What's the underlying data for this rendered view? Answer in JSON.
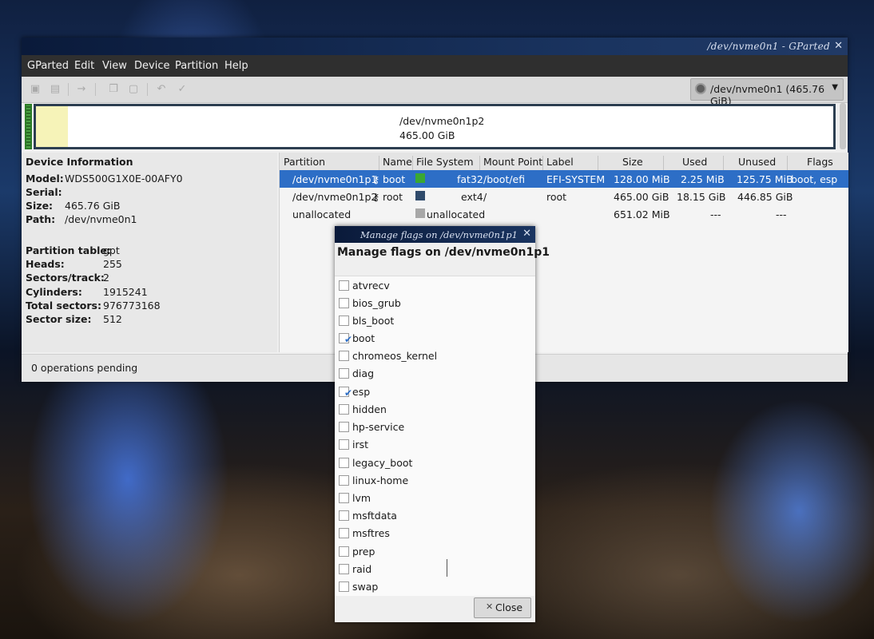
{
  "window": {
    "title": "/dev/nvme0n1 - GParted"
  },
  "menu": [
    "GParted",
    "Edit",
    "View",
    "Device",
    "Partition",
    "Help"
  ],
  "device_selector": "/dev/nvme0n1 (465.76 GiB)",
  "graph": {
    "label": "/dev/nvme0n1p2",
    "size": "465.00 GiB",
    "used_fraction": 0.04
  },
  "device_info": {
    "header": "Device Information",
    "rows": [
      {
        "k": "Model:",
        "v": "WDS500G1X0E-00AFY0"
      },
      {
        "k": "Serial:",
        "v": ""
      },
      {
        "k": "Size:",
        "v": "465.76 GiB"
      },
      {
        "k": "Path:",
        "v": "/dev/nvme0n1"
      }
    ],
    "rows2": [
      {
        "k": "Partition table:",
        "v": "gpt"
      },
      {
        "k": "Heads:",
        "v": "255"
      },
      {
        "k": "Sectors/track:",
        "v": "2"
      },
      {
        "k": "Cylinders:",
        "v": "1915241"
      },
      {
        "k": "Total sectors:",
        "v": "976773168"
      },
      {
        "k": "Sector size:",
        "v": "512"
      }
    ]
  },
  "table": {
    "headers": [
      "Partition",
      "Name",
      "File System",
      "Mount Point",
      "Label",
      "Size",
      "Used",
      "Unused",
      "Flags"
    ],
    "rows": [
      {
        "partition": "/dev/nvme0n1p1",
        "name": "boot",
        "fs": "fat32",
        "fs_color": "#3aa832",
        "mount": "/boot/efi",
        "label": "EFI-SYSTEM",
        "size": "128.00 MiB",
        "used": "2.25 MiB",
        "unused": "125.75 MiB",
        "flags": "boot, esp"
      },
      {
        "partition": "/dev/nvme0n1p2",
        "name": "root",
        "fs": "ext4",
        "fs_color": "#2f4a6b",
        "mount": "/",
        "label": "root",
        "size": "465.00 GiB",
        "used": "18.15 GiB",
        "unused": "446.85 GiB",
        "flags": ""
      },
      {
        "partition": "unallocated",
        "name": "",
        "fs": "unallocated",
        "fs_color": "#a8a8a8",
        "mount": "",
        "label": "",
        "size": "651.02 MiB",
        "used": "---",
        "unused": "---",
        "flags": ""
      }
    ]
  },
  "status": "0 operations pending",
  "dialog": {
    "title": "Manage flags on /dev/nvme0n1p1",
    "heading": "Manage flags on /dev/nvme0n1p1",
    "flags": [
      {
        "name": "atvrecv",
        "checked": false
      },
      {
        "name": "bios_grub",
        "checked": false
      },
      {
        "name": "bls_boot",
        "checked": false
      },
      {
        "name": "boot",
        "checked": true
      },
      {
        "name": "chromeos_kernel",
        "checked": false
      },
      {
        "name": "diag",
        "checked": false
      },
      {
        "name": "esp",
        "checked": true
      },
      {
        "name": "hidden",
        "checked": false
      },
      {
        "name": "hp-service",
        "checked": false
      },
      {
        "name": "irst",
        "checked": false
      },
      {
        "name": "legacy_boot",
        "checked": false
      },
      {
        "name": "linux-home",
        "checked": false
      },
      {
        "name": "lvm",
        "checked": false
      },
      {
        "name": "msftdata",
        "checked": false
      },
      {
        "name": "msftres",
        "checked": false
      },
      {
        "name": "prep",
        "checked": false
      },
      {
        "name": "raid",
        "checked": false
      },
      {
        "name": "swap",
        "checked": false
      }
    ],
    "close_label": "Close"
  }
}
